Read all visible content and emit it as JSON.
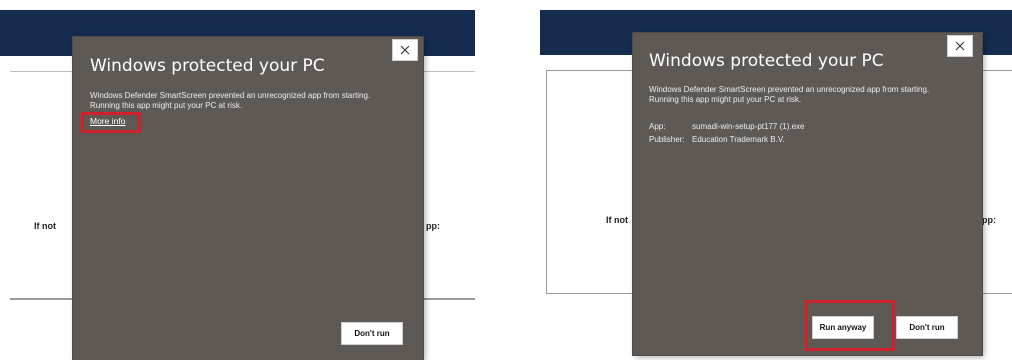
{
  "colors": {
    "banner": "#152c4f",
    "dialog_bg": "#5e5955",
    "highlight": "#d0202c",
    "button_bg": "#ffffff"
  },
  "left": {
    "background": {
      "peek_left": "If not",
      "peek_right": "pp:"
    },
    "dialog": {
      "title": "Windows protected your PC",
      "message": "Windows Defender SmartScreen prevented an unrecognized app from starting. Running this app might put your PC at risk.",
      "more_info_link": "More info",
      "close_icon": "close-icon",
      "dont_run_button": "Don't run"
    }
  },
  "right": {
    "background": {
      "peek_left": "If not",
      "peek_right": "pp:"
    },
    "dialog": {
      "title": "Windows protected your PC",
      "message": "Windows Defender SmartScreen prevented an unrecognized app from starting. Running this app might put your PC at risk.",
      "app_label": "App:",
      "app_value": "sumadi-win-setup-pt177 (1).exe",
      "publisher_label": "Publisher:",
      "publisher_value": "Education Trademark B.V.",
      "close_icon": "close-icon",
      "run_anyway_button": "Run anyway",
      "dont_run_button": "Don't run"
    }
  }
}
